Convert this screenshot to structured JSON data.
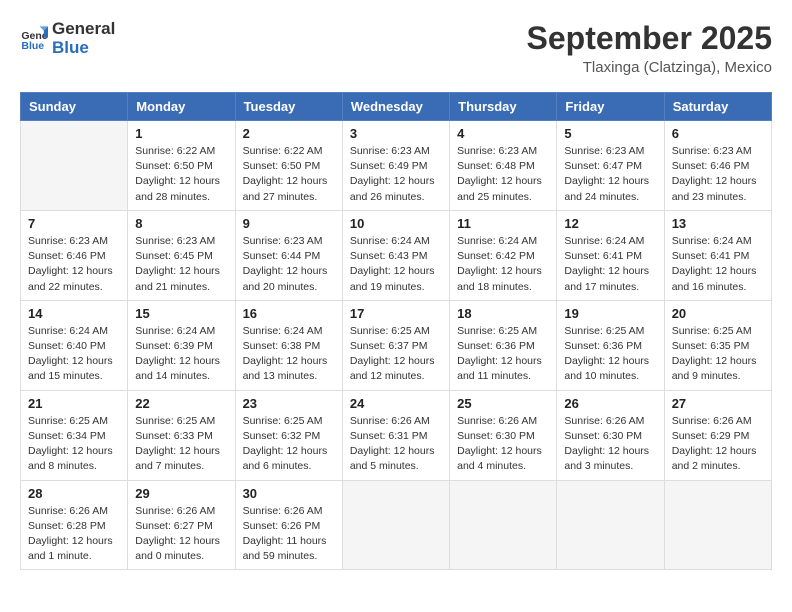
{
  "logo": {
    "general": "General",
    "blue": "Blue"
  },
  "header": {
    "month": "September 2025",
    "location": "Tlaxinga (Clatzinga), Mexico"
  },
  "weekdays": [
    "Sunday",
    "Monday",
    "Tuesday",
    "Wednesday",
    "Thursday",
    "Friday",
    "Saturday"
  ],
  "weeks": [
    [
      {
        "day": null,
        "info": null
      },
      {
        "day": "1",
        "info": "Sunrise: 6:22 AM\nSunset: 6:50 PM\nDaylight: 12 hours\nand 28 minutes."
      },
      {
        "day": "2",
        "info": "Sunrise: 6:22 AM\nSunset: 6:50 PM\nDaylight: 12 hours\nand 27 minutes."
      },
      {
        "day": "3",
        "info": "Sunrise: 6:23 AM\nSunset: 6:49 PM\nDaylight: 12 hours\nand 26 minutes."
      },
      {
        "day": "4",
        "info": "Sunrise: 6:23 AM\nSunset: 6:48 PM\nDaylight: 12 hours\nand 25 minutes."
      },
      {
        "day": "5",
        "info": "Sunrise: 6:23 AM\nSunset: 6:47 PM\nDaylight: 12 hours\nand 24 minutes."
      },
      {
        "day": "6",
        "info": "Sunrise: 6:23 AM\nSunset: 6:46 PM\nDaylight: 12 hours\nand 23 minutes."
      }
    ],
    [
      {
        "day": "7",
        "info": "Sunrise: 6:23 AM\nSunset: 6:46 PM\nDaylight: 12 hours\nand 22 minutes."
      },
      {
        "day": "8",
        "info": "Sunrise: 6:23 AM\nSunset: 6:45 PM\nDaylight: 12 hours\nand 21 minutes."
      },
      {
        "day": "9",
        "info": "Sunrise: 6:23 AM\nSunset: 6:44 PM\nDaylight: 12 hours\nand 20 minutes."
      },
      {
        "day": "10",
        "info": "Sunrise: 6:24 AM\nSunset: 6:43 PM\nDaylight: 12 hours\nand 19 minutes."
      },
      {
        "day": "11",
        "info": "Sunrise: 6:24 AM\nSunset: 6:42 PM\nDaylight: 12 hours\nand 18 minutes."
      },
      {
        "day": "12",
        "info": "Sunrise: 6:24 AM\nSunset: 6:41 PM\nDaylight: 12 hours\nand 17 minutes."
      },
      {
        "day": "13",
        "info": "Sunrise: 6:24 AM\nSunset: 6:41 PM\nDaylight: 12 hours\nand 16 minutes."
      }
    ],
    [
      {
        "day": "14",
        "info": "Sunrise: 6:24 AM\nSunset: 6:40 PM\nDaylight: 12 hours\nand 15 minutes."
      },
      {
        "day": "15",
        "info": "Sunrise: 6:24 AM\nSunset: 6:39 PM\nDaylight: 12 hours\nand 14 minutes."
      },
      {
        "day": "16",
        "info": "Sunrise: 6:24 AM\nSunset: 6:38 PM\nDaylight: 12 hours\nand 13 minutes."
      },
      {
        "day": "17",
        "info": "Sunrise: 6:25 AM\nSunset: 6:37 PM\nDaylight: 12 hours\nand 12 minutes."
      },
      {
        "day": "18",
        "info": "Sunrise: 6:25 AM\nSunset: 6:36 PM\nDaylight: 12 hours\nand 11 minutes."
      },
      {
        "day": "19",
        "info": "Sunrise: 6:25 AM\nSunset: 6:36 PM\nDaylight: 12 hours\nand 10 minutes."
      },
      {
        "day": "20",
        "info": "Sunrise: 6:25 AM\nSunset: 6:35 PM\nDaylight: 12 hours\nand 9 minutes."
      }
    ],
    [
      {
        "day": "21",
        "info": "Sunrise: 6:25 AM\nSunset: 6:34 PM\nDaylight: 12 hours\nand 8 minutes."
      },
      {
        "day": "22",
        "info": "Sunrise: 6:25 AM\nSunset: 6:33 PM\nDaylight: 12 hours\nand 7 minutes."
      },
      {
        "day": "23",
        "info": "Sunrise: 6:25 AM\nSunset: 6:32 PM\nDaylight: 12 hours\nand 6 minutes."
      },
      {
        "day": "24",
        "info": "Sunrise: 6:26 AM\nSunset: 6:31 PM\nDaylight: 12 hours\nand 5 minutes."
      },
      {
        "day": "25",
        "info": "Sunrise: 6:26 AM\nSunset: 6:30 PM\nDaylight: 12 hours\nand 4 minutes."
      },
      {
        "day": "26",
        "info": "Sunrise: 6:26 AM\nSunset: 6:30 PM\nDaylight: 12 hours\nand 3 minutes."
      },
      {
        "day": "27",
        "info": "Sunrise: 6:26 AM\nSunset: 6:29 PM\nDaylight: 12 hours\nand 2 minutes."
      }
    ],
    [
      {
        "day": "28",
        "info": "Sunrise: 6:26 AM\nSunset: 6:28 PM\nDaylight: 12 hours\nand 1 minute."
      },
      {
        "day": "29",
        "info": "Sunrise: 6:26 AM\nSunset: 6:27 PM\nDaylight: 12 hours\nand 0 minutes."
      },
      {
        "day": "30",
        "info": "Sunrise: 6:26 AM\nSunset: 6:26 PM\nDaylight: 11 hours\nand 59 minutes."
      },
      {
        "day": null,
        "info": null
      },
      {
        "day": null,
        "info": null
      },
      {
        "day": null,
        "info": null
      },
      {
        "day": null,
        "info": null
      }
    ]
  ]
}
